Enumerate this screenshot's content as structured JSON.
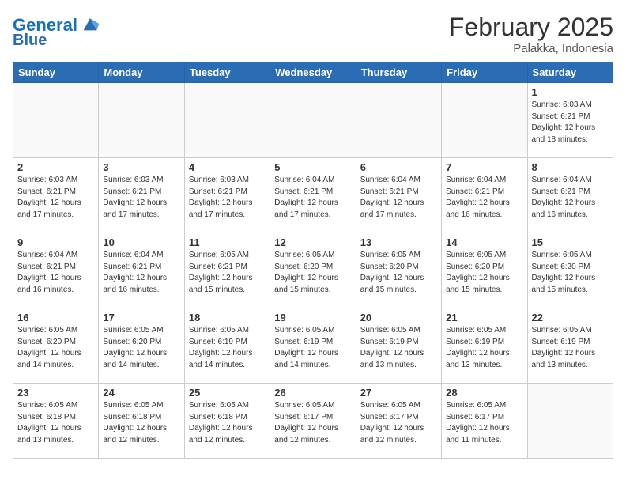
{
  "header": {
    "logo_line1": "General",
    "logo_line2": "Blue",
    "month": "February 2025",
    "location": "Palakka, Indonesia"
  },
  "weekdays": [
    "Sunday",
    "Monday",
    "Tuesday",
    "Wednesday",
    "Thursday",
    "Friday",
    "Saturday"
  ],
  "weeks": [
    [
      {
        "day": "",
        "info": ""
      },
      {
        "day": "",
        "info": ""
      },
      {
        "day": "",
        "info": ""
      },
      {
        "day": "",
        "info": ""
      },
      {
        "day": "",
        "info": ""
      },
      {
        "day": "",
        "info": ""
      },
      {
        "day": "1",
        "info": "Sunrise: 6:03 AM\nSunset: 6:21 PM\nDaylight: 12 hours\nand 18 minutes."
      }
    ],
    [
      {
        "day": "2",
        "info": "Sunrise: 6:03 AM\nSunset: 6:21 PM\nDaylight: 12 hours\nand 17 minutes."
      },
      {
        "day": "3",
        "info": "Sunrise: 6:03 AM\nSunset: 6:21 PM\nDaylight: 12 hours\nand 17 minutes."
      },
      {
        "day": "4",
        "info": "Sunrise: 6:03 AM\nSunset: 6:21 PM\nDaylight: 12 hours\nand 17 minutes."
      },
      {
        "day": "5",
        "info": "Sunrise: 6:04 AM\nSunset: 6:21 PM\nDaylight: 12 hours\nand 17 minutes."
      },
      {
        "day": "6",
        "info": "Sunrise: 6:04 AM\nSunset: 6:21 PM\nDaylight: 12 hours\nand 17 minutes."
      },
      {
        "day": "7",
        "info": "Sunrise: 6:04 AM\nSunset: 6:21 PM\nDaylight: 12 hours\nand 16 minutes."
      },
      {
        "day": "8",
        "info": "Sunrise: 6:04 AM\nSunset: 6:21 PM\nDaylight: 12 hours\nand 16 minutes."
      }
    ],
    [
      {
        "day": "9",
        "info": "Sunrise: 6:04 AM\nSunset: 6:21 PM\nDaylight: 12 hours\nand 16 minutes."
      },
      {
        "day": "10",
        "info": "Sunrise: 6:04 AM\nSunset: 6:21 PM\nDaylight: 12 hours\nand 16 minutes."
      },
      {
        "day": "11",
        "info": "Sunrise: 6:05 AM\nSunset: 6:21 PM\nDaylight: 12 hours\nand 15 minutes."
      },
      {
        "day": "12",
        "info": "Sunrise: 6:05 AM\nSunset: 6:20 PM\nDaylight: 12 hours\nand 15 minutes."
      },
      {
        "day": "13",
        "info": "Sunrise: 6:05 AM\nSunset: 6:20 PM\nDaylight: 12 hours\nand 15 minutes."
      },
      {
        "day": "14",
        "info": "Sunrise: 6:05 AM\nSunset: 6:20 PM\nDaylight: 12 hours\nand 15 minutes."
      },
      {
        "day": "15",
        "info": "Sunrise: 6:05 AM\nSunset: 6:20 PM\nDaylight: 12 hours\nand 15 minutes."
      }
    ],
    [
      {
        "day": "16",
        "info": "Sunrise: 6:05 AM\nSunset: 6:20 PM\nDaylight: 12 hours\nand 14 minutes."
      },
      {
        "day": "17",
        "info": "Sunrise: 6:05 AM\nSunset: 6:20 PM\nDaylight: 12 hours\nand 14 minutes."
      },
      {
        "day": "18",
        "info": "Sunrise: 6:05 AM\nSunset: 6:19 PM\nDaylight: 12 hours\nand 14 minutes."
      },
      {
        "day": "19",
        "info": "Sunrise: 6:05 AM\nSunset: 6:19 PM\nDaylight: 12 hours\nand 14 minutes."
      },
      {
        "day": "20",
        "info": "Sunrise: 6:05 AM\nSunset: 6:19 PM\nDaylight: 12 hours\nand 13 minutes."
      },
      {
        "day": "21",
        "info": "Sunrise: 6:05 AM\nSunset: 6:19 PM\nDaylight: 12 hours\nand 13 minutes."
      },
      {
        "day": "22",
        "info": "Sunrise: 6:05 AM\nSunset: 6:19 PM\nDaylight: 12 hours\nand 13 minutes."
      }
    ],
    [
      {
        "day": "23",
        "info": "Sunrise: 6:05 AM\nSunset: 6:18 PM\nDaylight: 12 hours\nand 13 minutes."
      },
      {
        "day": "24",
        "info": "Sunrise: 6:05 AM\nSunset: 6:18 PM\nDaylight: 12 hours\nand 12 minutes."
      },
      {
        "day": "25",
        "info": "Sunrise: 6:05 AM\nSunset: 6:18 PM\nDaylight: 12 hours\nand 12 minutes."
      },
      {
        "day": "26",
        "info": "Sunrise: 6:05 AM\nSunset: 6:17 PM\nDaylight: 12 hours\nand 12 minutes."
      },
      {
        "day": "27",
        "info": "Sunrise: 6:05 AM\nSunset: 6:17 PM\nDaylight: 12 hours\nand 12 minutes."
      },
      {
        "day": "28",
        "info": "Sunrise: 6:05 AM\nSunset: 6:17 PM\nDaylight: 12 hours\nand 11 minutes."
      },
      {
        "day": "",
        "info": ""
      }
    ]
  ]
}
